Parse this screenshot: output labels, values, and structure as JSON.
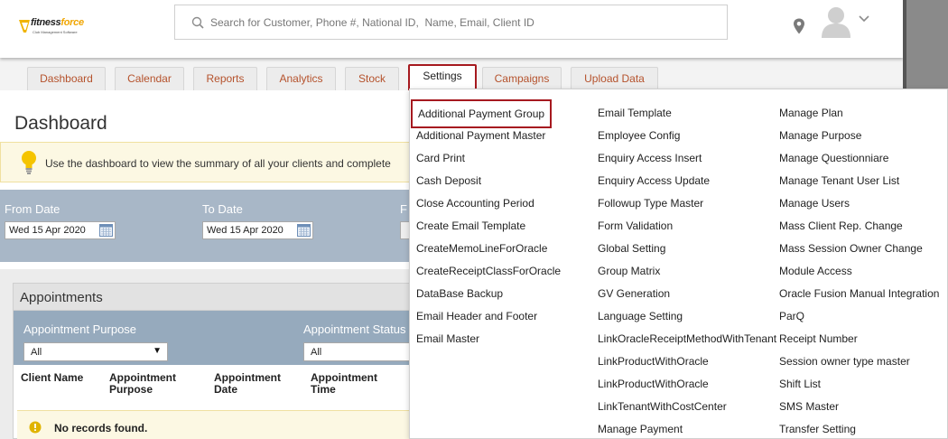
{
  "brand": {
    "name_part1": "fitness",
    "name_part2": "force",
    "tagline": "Club Management Software"
  },
  "search": {
    "placeholder": "Search for Customer, Phone #, National ID,  Name, Email, Client ID"
  },
  "tabs": [
    {
      "label": "Dashboard"
    },
    {
      "label": "Calendar"
    },
    {
      "label": "Reports"
    },
    {
      "label": "Analytics"
    },
    {
      "label": "Stock"
    },
    {
      "label": "Settings",
      "active": true
    },
    {
      "label": "Campaigns"
    },
    {
      "label": "Upload Data"
    }
  ],
  "dashboard": {
    "title": "Dashboard",
    "notice": "Use the dashboard to view the summary of all your clients and complete",
    "from_label": "From Date",
    "from_value": "Wed 15 Apr 2020",
    "to_label": "To Date",
    "to_value": "Wed 15 Apr 2020",
    "cut_label": "F",
    "appointments": {
      "title": "Appointments",
      "purpose_label": "Appointment Purpose",
      "purpose_value": "All",
      "status_label": "Appointment Status",
      "status_value": "All",
      "columns": [
        "Client Name",
        "Appointment Purpose",
        "Appointment Date",
        "Appointment Time"
      ],
      "empty_message": "No records found."
    }
  },
  "settings_menu": {
    "columns": [
      [
        "Additional Payment Group",
        "Additional Payment Master",
        "Card Print",
        "Cash Deposit",
        "Close Accounting Period",
        "Create Email Template",
        "CreateMemoLineForOracle",
        "CreateReceiptClassForOracle",
        "DataBase Backup",
        "Email Header and Footer",
        "Email Master"
      ],
      [
        "Email Template",
        "Employee Config",
        "Enquiry Access Insert",
        "Enquiry Access Update",
        "Followup Type Master",
        "Form Validation",
        "Global Setting",
        "Group Matrix",
        "GV Generation",
        "Language Setting",
        "LinkOracleReceiptMethodWithTenant",
        "LinkProductWithOracle",
        "LinkProductWithOracle",
        "LinkTenantWithCostCenter",
        "Manage Payment"
      ],
      [
        "Manage Plan",
        "Manage Purpose",
        "Manage Questionniare",
        "Manage Tenant User List",
        "Manage Users",
        "Mass Client Rep. Change",
        "Mass Session Owner Change",
        "Module Access",
        "Oracle Fusion Manual Integration",
        "ParQ",
        "Receipt Number",
        "Session owner type master",
        "Shift List",
        "SMS Master",
        "Transfer Setting"
      ]
    ],
    "highlighted_item": "Additional Payment Group"
  },
  "colors": {
    "tab_text": "#b5522c",
    "highlight_border": "#a6191f",
    "filter_bar": "#a8b7c7",
    "notice_bg": "#fcf8e3"
  }
}
